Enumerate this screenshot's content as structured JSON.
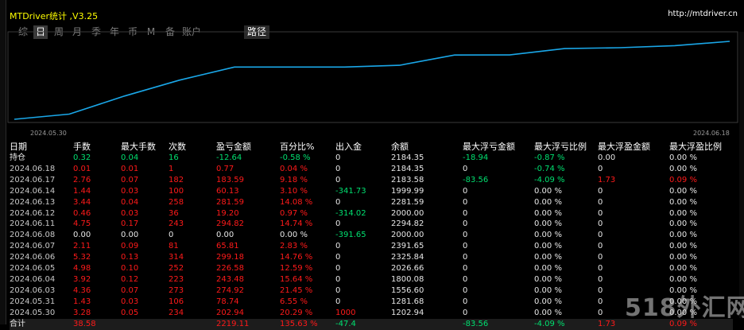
{
  "window": {
    "title": "MTDriver统计 ,V3.25",
    "url": "http://mtdriver.cn"
  },
  "tabs": [
    {
      "label": "综",
      "active": false
    },
    {
      "label": "日",
      "active": true
    },
    {
      "label": "周",
      "active": false
    },
    {
      "label": "月",
      "active": false
    },
    {
      "label": "季",
      "active": false
    },
    {
      "label": "年",
      "active": false
    },
    {
      "label": "币",
      "active": false
    },
    {
      "label": "M",
      "active": false
    },
    {
      "label": "备",
      "active": false
    },
    {
      "label": "账户",
      "active": false
    }
  ],
  "path_tab": "路径",
  "chart_data": {
    "type": "line",
    "x": [
      "2024.05.30",
      "2024.05.31",
      "2024.06.03",
      "2024.06.04",
      "2024.06.05",
      "2024.06.06",
      "2024.06.07",
      "2024.06.08",
      "2024.06.11",
      "2024.06.12",
      "2024.06.13",
      "2024.06.14",
      "2024.06.17",
      "2024.06.18"
    ],
    "values": [
      1202.94,
      1281.68,
      1556.6,
      1800.08,
      2026.66,
      2325.84,
      2391.65,
      2000.0,
      2294.82,
      2000.0,
      2281.59,
      1999.99,
      2183.58,
      2184.35
    ],
    "x_tick_labels": [
      "2024.05.30",
      "2024.06.18"
    ],
    "line_color": "#1aa7e8",
    "grid": false
  },
  "table": {
    "headers": [
      "日期",
      "手数",
      "最大手数",
      "次数",
      "盈亏金额",
      "百分比%",
      "出入金",
      "余额",
      "最大浮亏金额",
      "最大浮亏比例",
      "最大浮盈金额",
      "最大浮盈比例"
    ],
    "rows": [
      {
        "type": "hold",
        "cells": [
          "持仓",
          "0.32",
          "0.04",
          "16",
          "-12.64",
          "-0.58 %",
          "0",
          "2184.35",
          "-18.94",
          "-0.87 %",
          "0.00",
          "0.00 %"
        ],
        "colors": [
          "white",
          "green",
          "green",
          "green",
          "green",
          "green",
          "white",
          "white",
          "green",
          "green",
          "white",
          "white"
        ]
      },
      {
        "type": "day",
        "cells": [
          "2024.06.18",
          "0.01",
          "0.01",
          "1",
          "0.77",
          "0.04 %",
          "0",
          "2184.35",
          "0",
          "-0.74 %",
          "0",
          "0.00 %"
        ],
        "colors": [
          "grey",
          "red",
          "red",
          "red",
          "red",
          "red",
          "white",
          "white",
          "white",
          "green",
          "white",
          "white"
        ]
      },
      {
        "type": "day",
        "cells": [
          "2024.06.17",
          "2.76",
          "0.07",
          "182",
          "183.59",
          "9.18 %",
          "0",
          "2183.58",
          "-83.56",
          "-4.09 %",
          "1.73",
          "0.09 %"
        ],
        "colors": [
          "grey",
          "red",
          "red",
          "red",
          "red",
          "red",
          "white",
          "white",
          "green",
          "green",
          "red",
          "red"
        ]
      },
      {
        "type": "day",
        "cells": [
          "2024.06.14",
          "1.44",
          "0.03",
          "100",
          "60.13",
          "3.10 %",
          "-341.73",
          "1999.99",
          "0",
          "0.00 %",
          "0",
          "0.00 %"
        ],
        "colors": [
          "grey",
          "red",
          "red",
          "red",
          "red",
          "red",
          "green",
          "white",
          "white",
          "white",
          "white",
          "white"
        ]
      },
      {
        "type": "day",
        "cells": [
          "2024.06.13",
          "3.44",
          "0.04",
          "258",
          "281.59",
          "14.08 %",
          "0",
          "2281.59",
          "0",
          "0.00 %",
          "0",
          "0.00 %"
        ],
        "colors": [
          "grey",
          "red",
          "red",
          "red",
          "red",
          "red",
          "white",
          "white",
          "white",
          "white",
          "white",
          "white"
        ]
      },
      {
        "type": "day",
        "cells": [
          "2024.06.12",
          "0.46",
          "0.03",
          "36",
          "19.20",
          "0.97 %",
          "-314.02",
          "2000.00",
          "0",
          "0.00 %",
          "0",
          "0.00 %"
        ],
        "colors": [
          "grey",
          "red",
          "red",
          "red",
          "red",
          "red",
          "green",
          "white",
          "white",
          "white",
          "white",
          "white"
        ]
      },
      {
        "type": "day",
        "cells": [
          "2024.06.11",
          "4.75",
          "0.17",
          "243",
          "294.82",
          "14.74 %",
          "0",
          "2294.82",
          "0",
          "0.00 %",
          "0",
          "0.00 %"
        ],
        "colors": [
          "grey",
          "red",
          "red",
          "red",
          "red",
          "red",
          "white",
          "white",
          "white",
          "white",
          "white",
          "white"
        ]
      },
      {
        "type": "day",
        "cells": [
          "2024.06.08",
          "0.00",
          "0.00",
          "0",
          "0.00",
          "0.00 %",
          "-391.65",
          "2000.00",
          "0",
          "0.00 %",
          "0",
          "0.00 %"
        ],
        "colors": [
          "grey",
          "white",
          "white",
          "white",
          "white",
          "white",
          "green",
          "white",
          "white",
          "white",
          "white",
          "white"
        ]
      },
      {
        "type": "day",
        "cells": [
          "2024.06.07",
          "2.11",
          "0.09",
          "81",
          "65.81",
          "2.83 %",
          "0",
          "2391.65",
          "0",
          "0.00 %",
          "0",
          "0.00 %"
        ],
        "colors": [
          "grey",
          "red",
          "red",
          "red",
          "red",
          "red",
          "white",
          "white",
          "white",
          "white",
          "white",
          "white"
        ]
      },
      {
        "type": "day",
        "cells": [
          "2024.06.06",
          "5.32",
          "0.13",
          "314",
          "299.18",
          "14.76 %",
          "0",
          "2325.84",
          "0",
          "0.00 %",
          "0",
          "0.00 %"
        ],
        "colors": [
          "grey",
          "red",
          "red",
          "red",
          "red",
          "red",
          "white",
          "white",
          "white",
          "white",
          "white",
          "white"
        ]
      },
      {
        "type": "day",
        "cells": [
          "2024.06.05",
          "4.98",
          "0.10",
          "252",
          "226.58",
          "12.59 %",
          "0",
          "2026.66",
          "0",
          "0.00 %",
          "0",
          "0.00 %"
        ],
        "colors": [
          "grey",
          "red",
          "red",
          "red",
          "red",
          "red",
          "white",
          "white",
          "white",
          "white",
          "white",
          "white"
        ]
      },
      {
        "type": "day",
        "cells": [
          "2024.06.04",
          "3.92",
          "0.12",
          "223",
          "243.48",
          "15.64 %",
          "0",
          "1800.08",
          "0",
          "0.00 %",
          "0",
          "0.00 %"
        ],
        "colors": [
          "grey",
          "red",
          "red",
          "red",
          "red",
          "red",
          "white",
          "white",
          "white",
          "white",
          "white",
          "white"
        ]
      },
      {
        "type": "day",
        "cells": [
          "2024.06.03",
          "4.36",
          "0.07",
          "273",
          "274.92",
          "21.45 %",
          "0",
          "1556.60",
          "0",
          "0.00 %",
          "0",
          "0.00 %"
        ],
        "colors": [
          "grey",
          "red",
          "red",
          "red",
          "red",
          "red",
          "white",
          "white",
          "white",
          "white",
          "white",
          "white"
        ]
      },
      {
        "type": "day",
        "cells": [
          "2024.05.31",
          "1.43",
          "0.03",
          "106",
          "78.74",
          "6.55 %",
          "0",
          "1281.68",
          "0",
          "0.00 %",
          "0",
          "0.00 %"
        ],
        "colors": [
          "grey",
          "red",
          "red",
          "red",
          "red",
          "red",
          "white",
          "white",
          "white",
          "white",
          "white",
          "white"
        ]
      },
      {
        "type": "day",
        "cells": [
          "2024.05.30",
          "3.28",
          "0.05",
          "234",
          "202.94",
          "20.29 %",
          "1000",
          "1202.94",
          "0",
          "0.00 %",
          "0",
          "0.00 %"
        ],
        "colors": [
          "grey",
          "red",
          "red",
          "red",
          "red",
          "red",
          "red",
          "white",
          "white",
          "white",
          "white",
          "white"
        ]
      },
      {
        "type": "total",
        "cells": [
          "合计",
          "38.58",
          "",
          "",
          "2219.11",
          "135.63 %",
          "-47.4",
          "",
          "-83.56",
          "-4.09 %",
          "1.73",
          "0.09 %"
        ],
        "colors": [
          "white",
          "red",
          "red",
          "red",
          "red",
          "red",
          "green",
          "white",
          "green",
          "green",
          "red",
          "red"
        ]
      }
    ]
  },
  "watermark": "518外汇网"
}
